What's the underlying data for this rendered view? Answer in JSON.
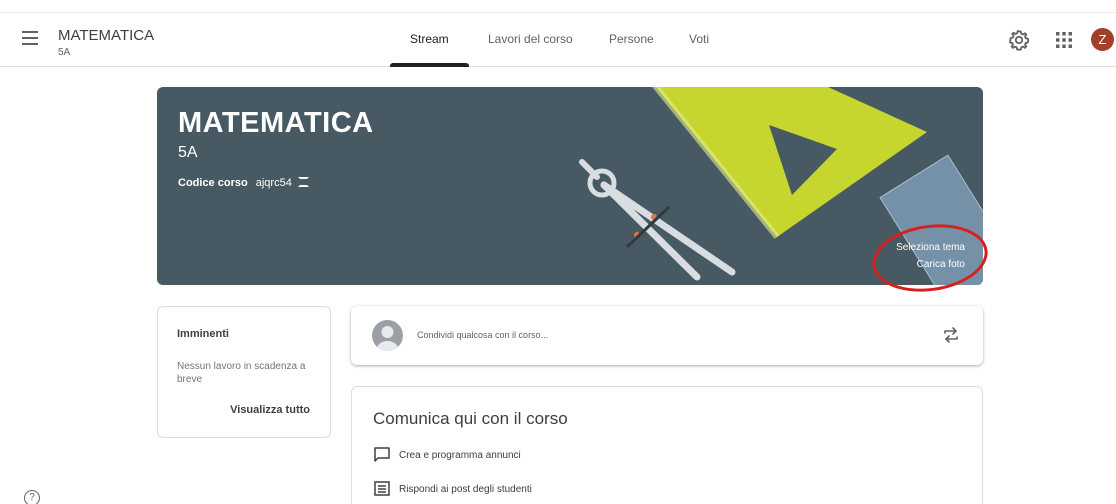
{
  "header": {
    "class_name": "MATEMATICA",
    "section": "5A",
    "tabs": [
      {
        "label": "Stream",
        "active": true
      },
      {
        "label": "Lavori del corso",
        "active": false
      },
      {
        "label": "Persone",
        "active": false
      },
      {
        "label": "Voti",
        "active": false
      }
    ],
    "avatar_initial": "Z",
    "icons": [
      "menu-icon",
      "gear-icon",
      "apps-grid-icon"
    ]
  },
  "banner": {
    "title": "MATEMATICA",
    "section": "5A",
    "code_label": "Codice corso",
    "code_value": "ajqrc54",
    "select_theme": "Seleziona tema",
    "upload_photo": "Carica foto",
    "background_color": "#475a63"
  },
  "upcoming": {
    "title": "Imminenti",
    "empty_text": "Nessun lavoro in scadenza a breve",
    "view_all": "Visualizza tutto"
  },
  "share": {
    "placeholder": "Condividi qualcosa con il corso..."
  },
  "communicate": {
    "title": "Comunica qui con il corso",
    "items": [
      {
        "label": "Crea e programma annunci",
        "icon": "announcement-icon"
      },
      {
        "label": "Rispondi ai post degli studenti",
        "icon": "reply-icon"
      }
    ]
  },
  "colors": {
    "accent": "#202124",
    "highlight_ring": "#d61f1f",
    "avatar": "#a0402a"
  }
}
